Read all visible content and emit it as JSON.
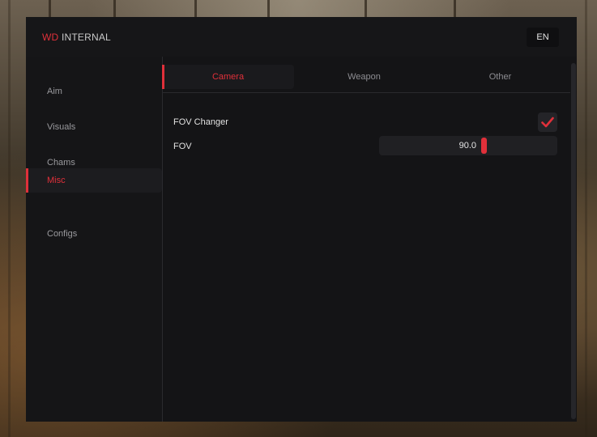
{
  "brand": {
    "accent": "WD",
    "name": "INTERNAL"
  },
  "language_button": {
    "label": "EN"
  },
  "sidebar": {
    "items": [
      {
        "label": "Aim",
        "active": false
      },
      {
        "label": "Visuals",
        "active": false
      },
      {
        "label": "Chams",
        "active": false
      },
      {
        "label": "Misc",
        "active": true
      },
      {
        "label": "Configs",
        "active": false
      }
    ]
  },
  "tabs": [
    {
      "label": "Camera",
      "active": true
    },
    {
      "label": "Weapon",
      "active": false
    },
    {
      "label": "Other",
      "active": false
    }
  ],
  "camera": {
    "fov_changer": {
      "label": "FOV Changer",
      "checked": true,
      "icon": "checkmark-icon"
    },
    "fov": {
      "label": "FOV",
      "value": "90.0"
    }
  },
  "colors": {
    "accent": "#e0303a",
    "panel_bg": "#141416",
    "text_primary": "#e2e2e2",
    "text_muted": "#9a9a9e"
  }
}
